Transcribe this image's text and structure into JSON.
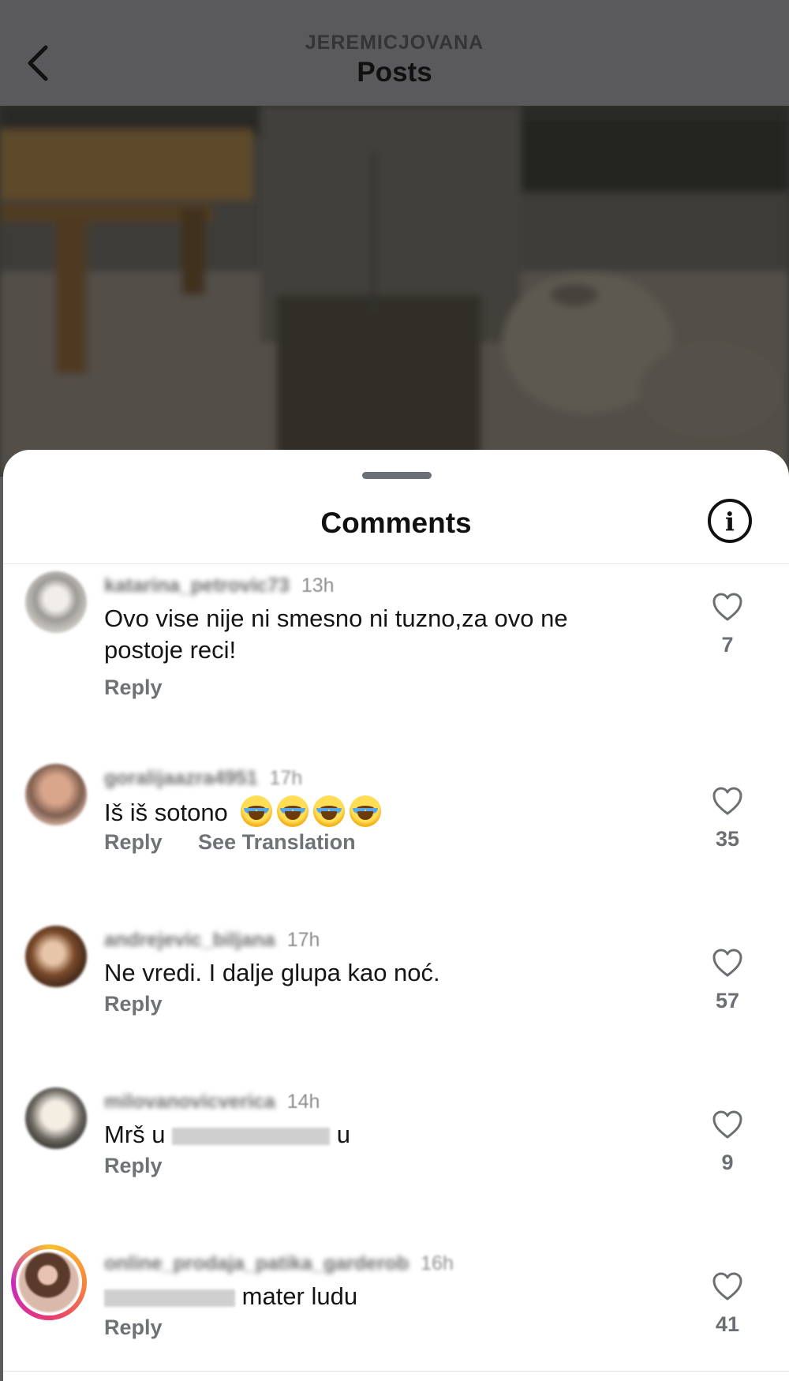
{
  "header": {
    "username": "JEREMICJOVANA",
    "title": "Posts"
  },
  "sheet": {
    "title": "Comments"
  },
  "comments": [
    {
      "username": "katarina_petrovic73",
      "time": "13h",
      "text": "Ovo vise nije ni smesno ni tuzno,za ovo ne postoje reci!",
      "reply": "Reply",
      "likes": "7"
    },
    {
      "username": "goralijaazra4951",
      "time": "17h",
      "text": "Iš iš sotono",
      "emoji": "face-with-tears-of-joy x4",
      "reply": "Reply",
      "translate": "See Translation",
      "likes": "35"
    },
    {
      "username": "andrejevic_biljana",
      "time": "17h",
      "text": "Ne vredi. I dalje glupa kao noć.",
      "reply": "Reply",
      "likes": "57"
    },
    {
      "username": "milovanovicverica",
      "time": "14h",
      "text_start": "Mrš u",
      "text_end": "u",
      "reply": "Reply",
      "likes": "9"
    },
    {
      "username": "online_prodaja_patika_garderob",
      "time": "16h",
      "text_end": "mater ludu",
      "reply": "Reply",
      "likes": "41"
    }
  ],
  "colors": {
    "header_bg": "#5a5a5c",
    "sheet_bg": "#ffffff",
    "secondary_text": "#6f7276",
    "story_ring": "#e63a74"
  }
}
